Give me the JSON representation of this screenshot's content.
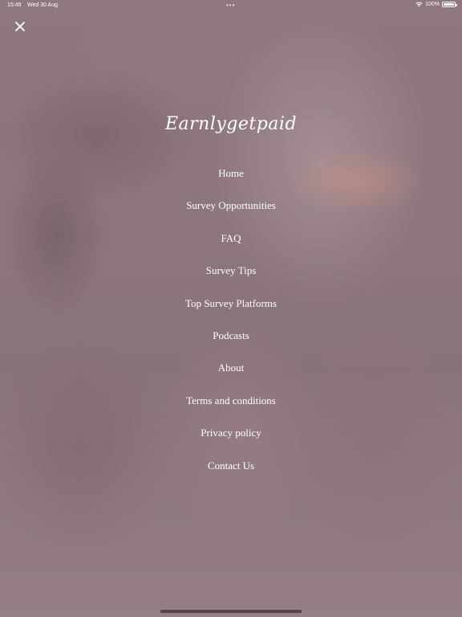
{
  "status_bar": {
    "time": "15:49",
    "date": "Wed 30 Aug",
    "center_dots": "•••",
    "battery_percent": "100%",
    "icons": [
      "wifi-icon",
      "battery-icon"
    ]
  },
  "header": {
    "close_icon": "close-icon",
    "brand": "Earnlygetpaid"
  },
  "nav": {
    "items": [
      {
        "label": "Home"
      },
      {
        "label": "Survey Opportunities"
      },
      {
        "label": "FAQ"
      },
      {
        "label": "Survey Tips"
      },
      {
        "label": "Top Survey Platforms"
      },
      {
        "label": "Podcasts"
      },
      {
        "label": "About"
      },
      {
        "label": "Terms and conditions"
      },
      {
        "label": "Privacy policy"
      },
      {
        "label": "Contact Us"
      }
    ]
  },
  "colors": {
    "text": "#ffffff",
    "overlay_tint": "#8f7981"
  }
}
